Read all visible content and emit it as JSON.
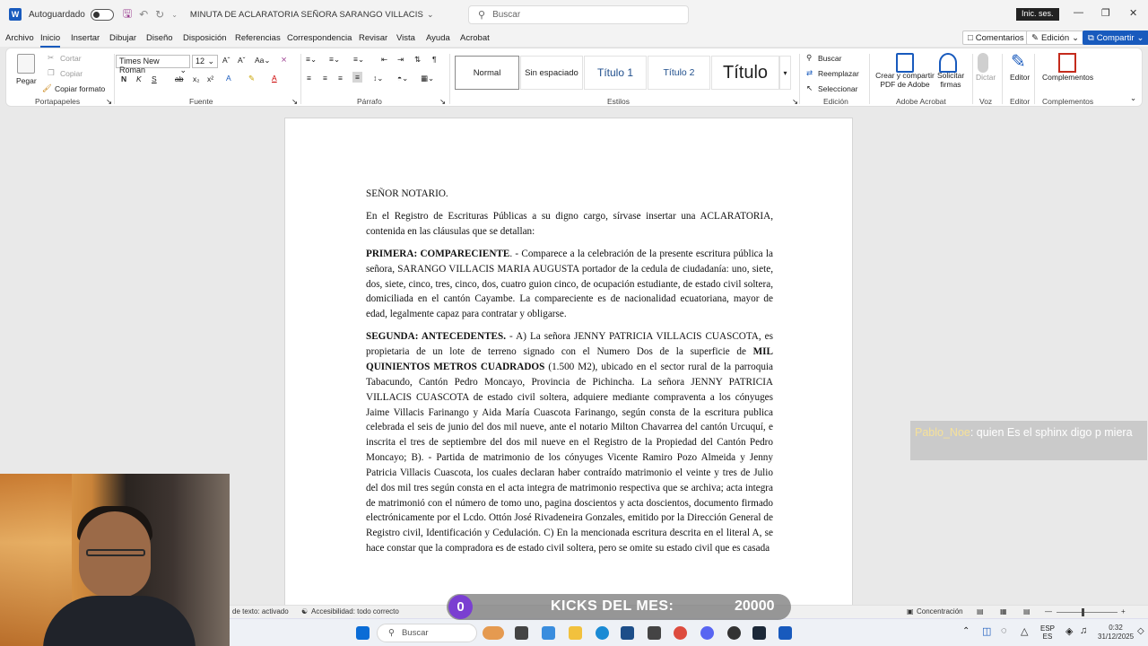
{
  "titlebar": {
    "autosave_label": "Autoguardado",
    "document_title": "MINUTA DE ACLARATORIA SEÑORA SARANGO VILLACIS",
    "search_placeholder": "Buscar",
    "signin_label": "Inic. ses."
  },
  "menu": {
    "tabs": [
      "Archivo",
      "Inicio",
      "Insertar",
      "Dibujar",
      "Diseño",
      "Disposición",
      "Referencias",
      "Correspondencia",
      "Revisar",
      "Vista",
      "Ayuda",
      "Acrobat"
    ],
    "comments_label": "Comentarios",
    "editing_label": "Edición",
    "share_label": "Compartir"
  },
  "ribbon": {
    "paste_label": "Pegar",
    "cut_label": "Cortar",
    "copy_label": "Copiar",
    "format_painter_label": "Copiar formato",
    "clipboard_group": "Portapapeles",
    "font_name": "Times New Roman",
    "font_size": "12",
    "font_group": "Fuente",
    "paragraph_group": "Párrafo",
    "styles": [
      "Normal",
      "Sin espaciado",
      "Título 1",
      "Título 2",
      "Título"
    ],
    "styles_group": "Estilos",
    "find_label": "Buscar",
    "replace_label": "Reemplazar",
    "select_label": "Seleccionar",
    "editing_group": "Edición",
    "create_pdf_label": "Crear y compartir PDF de Adobe",
    "request_signatures_label": "Solicitar firmas",
    "adobe_group": "Adobe Acrobat",
    "dictate_label": "Dictar",
    "voice_group": "Voz",
    "editor_label": "Editor",
    "editor_group": "Editor",
    "addins_label": "Complementos",
    "addins_group": "Complementos"
  },
  "document": {
    "greeting": "SEÑOR NOTARIO.",
    "intro": "En el Registro de Escrituras Públicas a su digno cargo, sírvase insertar una ACLARATORIA, contenida en las cláusulas que se detallan:",
    "first_heading": "PRIMERA: COMPARECIENTE",
    "first_body": ". - Comparece a la celebración de la presente escritura pública la señora, SARANGO VILLACIS MARIA AUGUSTA portador de la cedula de ciudadanía: uno, siete, dos, siete, cinco, tres, cinco, dos, cuatro guion cinco, de ocupación estudiante, de estado civil soltera, domiciliada en el cantón Cayambe. La compareciente es de nacionalidad ecuatoriana, mayor de edad, legalmente capaz para contratar y obligarse.",
    "second_heading": "SEGUNDA: ANTECEDENTES.",
    "second_body_a": " - A) La señora JENNY PATRICIA VILLACIS CUASCOTA, es propietaria de un lote de terreno signado con el Numero Dos de la superficie de ",
    "second_bold": "MIL QUINIENTOS METROS CUADRADOS",
    "second_body_b": " (1.500 M2), ubicado en el sector rural de la parroquia Tabacundo, Cantón Pedro Moncayo, Provincia de Pichincha. La señora JENNY PATRICIA VILLACIS CUASCOTA de estado civil soltera, adquiere mediante compraventa a los cónyuges Jaime Villacis Farinango y Aida María Cuascota Farinango, según consta de la escritura publica celebrada el seis de junio del dos mil nueve, ante el notario Milton Chavarrea del cantón Urcuquí, e inscrita el tres de septiembre del dos mil nueve en el Registro de la Propiedad del Cantón Pedro Moncayo; B). - Partida de matrimonio de los cónyuges Vicente Ramiro Pozo Almeida y Jenny Patricia Villacis Cuascota, los cuales declaran haber contraído matrimonio el veinte y tres de Julio del dos mil tres según consta en el acta integra de matrimonio respectiva que se archiva; acta integra de matrimonió con el número de tomo uno, pagina doscientos y acta doscientos, documento firmado electrónicamente por el Lcdo. Ottón José Rivadeneira Gonzales, emitido por la Dirección General de Registro civil, Identificación y Cedulación. C) En la mencionada escritura descrita en el literal A, se hace constar que la compradora es de estado civil soltera, pero se omite su estado civil que es casada"
  },
  "statusbar": {
    "text_prediction": "de texto: activado",
    "accessibility": "Accesibilidad: todo correcto",
    "focus": "Concentración"
  },
  "taskbar": {
    "search_label": "Buscar",
    "lang": "ESP\nES",
    "time": "0:32",
    "date": "31/12/2025"
  },
  "overlay": {
    "chat_user": "Pablo_Noe",
    "chat_message": ": quien Es el sphinx digo p miera",
    "kicks_count": "0",
    "kicks_label": "KICKS DEL MES:",
    "kicks_goal": "20000"
  },
  "colors": {
    "accent": "#185abd",
    "kick_badge": "#7a3fd1"
  }
}
